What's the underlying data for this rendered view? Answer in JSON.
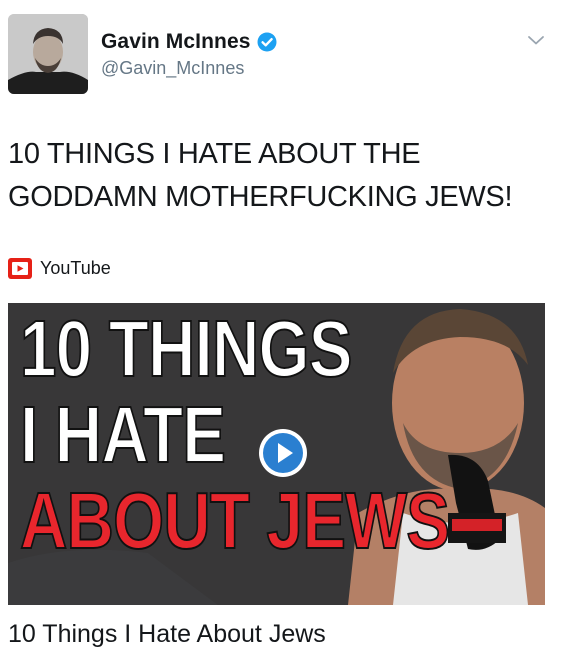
{
  "author": {
    "name": "Gavin McInnes",
    "handle": "@Gavin_McInnes",
    "verified": true
  },
  "tweet": {
    "text": "10 THINGS I HATE ABOUT THE GODDAMN MOTHERFUCKING JEWS!"
  },
  "card": {
    "source_label": "YouTube",
    "thumbnail_text": [
      "10 THINGS",
      "I HATE",
      "ABOUT JEWS"
    ],
    "title": "10 Things I Hate About Jews"
  },
  "colors": {
    "verified_blue": "#1da1f2",
    "youtube_red": "#e62117",
    "thumb_red": "#e8262d",
    "handle_gray": "#657786"
  },
  "icons": {
    "verified": "verified-badge-icon",
    "menu": "chevron-down-icon",
    "source": "youtube-icon",
    "play": "play-icon"
  }
}
